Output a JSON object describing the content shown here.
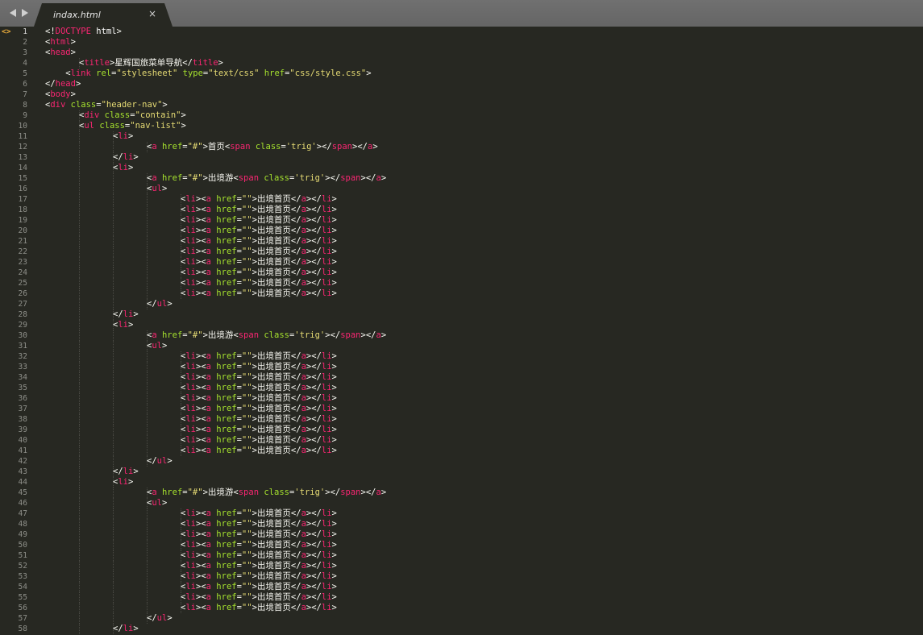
{
  "tab": {
    "title": "indax.html",
    "close_glyph": "×"
  },
  "nav": {
    "back_icon": "triangle-left-icon",
    "forward_icon": "triangle-right-icon"
  },
  "gutter": {
    "marker": "<>",
    "active_line": 1
  },
  "colors": {
    "tag": "#f92672",
    "attr": "#a6e22e",
    "string": "#e6db74",
    "text": "#f8f8f2",
    "line_number": "#8f908a",
    "background": "#272822",
    "tabbar": "#6b6b6b",
    "marker": "#e6a93b"
  },
  "lines": [
    "<!DOCTYPE html>",
    "<html>",
    "<head>",
    "\t<title>星辉国旅菜单导航</title>",
    "    <link rel=\"stylesheet\" type=\"text/css\" href=\"css/style.css\">",
    "</head>",
    "<body>",
    "<div class=\"header-nav\">",
    "\t<div class=\"contain\">",
    "\t<ul class=\"nav-list\">",
    "\t\t<li>",
    "\t\t\t<a href=\"#\">首页<span class='trig'></span></a>",
    "\t\t</li>",
    "\t\t<li>",
    "\t\t\t<a href=\"#\">出境游<span class='trig'></span></a>",
    "\t\t\t<ul>",
    "\t\t\t\t<li><a href=\"\">出境首页</a></li>",
    "\t\t\t\t<li><a href=\"\">出境首页</a></li>",
    "\t\t\t\t<li><a href=\"\">出境首页</a></li>",
    "\t\t\t\t<li><a href=\"\">出境首页</a></li>",
    "\t\t\t\t<li><a href=\"\">出境首页</a></li>",
    "\t\t\t\t<li><a href=\"\">出境首页</a></li>",
    "\t\t\t\t<li><a href=\"\">出境首页</a></li>",
    "\t\t\t\t<li><a href=\"\">出境首页</a></li>",
    "\t\t\t\t<li><a href=\"\">出境首页</a></li>",
    "\t\t\t\t<li><a href=\"\">出境首页</a></li>",
    "\t\t\t</ul>",
    "\t\t</li>",
    "\t\t<li>",
    "\t\t\t<a href=\"#\">出境游<span class='trig'></span></a>",
    "\t\t\t<ul>",
    "\t\t\t\t<li><a href=\"\">出境首页</a></li>",
    "\t\t\t\t<li><a href=\"\">出境首页</a></li>",
    "\t\t\t\t<li><a href=\"\">出境首页</a></li>",
    "\t\t\t\t<li><a href=\"\">出境首页</a></li>",
    "\t\t\t\t<li><a href=\"\">出境首页</a></li>",
    "\t\t\t\t<li><a href=\"\">出境首页</a></li>",
    "\t\t\t\t<li><a href=\"\">出境首页</a></li>",
    "\t\t\t\t<li><a href=\"\">出境首页</a></li>",
    "\t\t\t\t<li><a href=\"\">出境首页</a></li>",
    "\t\t\t\t<li><a href=\"\">出境首页</a></li>",
    "\t\t\t</ul>",
    "\t\t</li>",
    "\t\t<li>",
    "\t\t\t<a href=\"#\">出境游<span class='trig'></span></a>",
    "\t\t\t<ul>",
    "\t\t\t\t<li><a href=\"\">出境首页</a></li>",
    "\t\t\t\t<li><a href=\"\">出境首页</a></li>",
    "\t\t\t\t<li><a href=\"\">出境首页</a></li>",
    "\t\t\t\t<li><a href=\"\">出境首页</a></li>",
    "\t\t\t\t<li><a href=\"\">出境首页</a></li>",
    "\t\t\t\t<li><a href=\"\">出境首页</a></li>",
    "\t\t\t\t<li><a href=\"\">出境首页</a></li>",
    "\t\t\t\t<li><a href=\"\">出境首页</a></li>",
    "\t\t\t\t<li><a href=\"\">出境首页</a></li>",
    "\t\t\t\t<li><a href=\"\">出境首页</a></li>",
    "\t\t\t</ul>",
    "\t\t</li>"
  ]
}
